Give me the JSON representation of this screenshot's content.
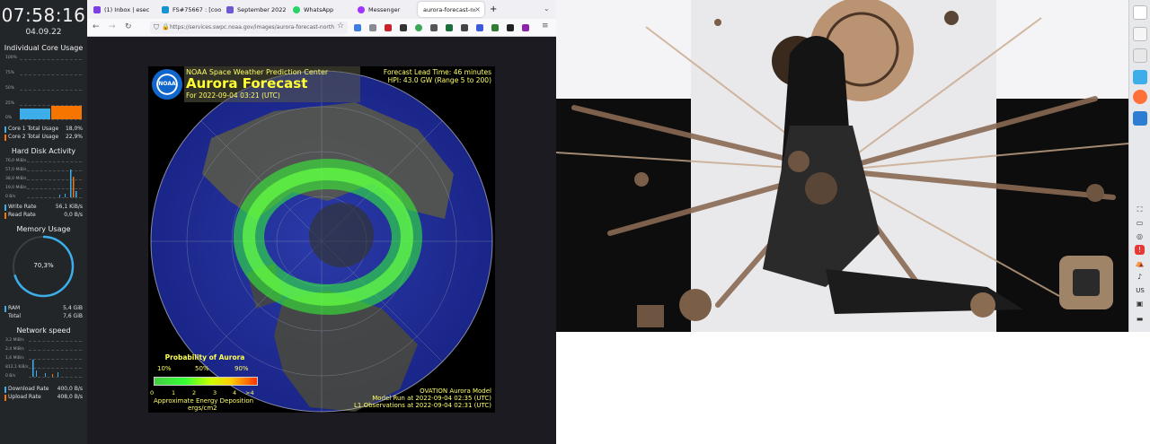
{
  "sysmon": {
    "clock": "07:58:16",
    "date": "04.09.22",
    "cpu": {
      "title": "Individual Core Usage",
      "axis": [
        "100%",
        "75%",
        "50%",
        "25%",
        "0%"
      ],
      "cores": [
        {
          "label": "Core 1 Total Usage",
          "value": "18,0%",
          "fraction": 0.18,
          "color": "#3daee9"
        },
        {
          "label": "Core 2 Total Usage",
          "value": "22,9%",
          "fraction": 0.229,
          "color": "#f67400"
        }
      ]
    },
    "disk": {
      "title": "Hard Disk Activity",
      "axis": [
        "76,0 MiB/s",
        "57,0 MiB/s",
        "38,0 MiB/s",
        "19,0 MiB/s",
        "0 B/s"
      ],
      "rows": [
        {
          "label": "Write Rate",
          "value": "56,1 KiB/s",
          "color": "#3daee9"
        },
        {
          "label": "Read Rate",
          "value": "0,0 B/s",
          "color": "#f67400"
        }
      ]
    },
    "memory": {
      "title": "Memory Usage",
      "percent_label": "70,3%",
      "fraction": 0.703,
      "rows": [
        {
          "label": "RAM",
          "value": "5,4 GiB",
          "color": "#3daee9"
        },
        {
          "label": "Total",
          "value": "7,6 GiB",
          "color": ""
        }
      ]
    },
    "network": {
      "title": "Network speed",
      "axis": [
        "3,2 MiB/s",
        "2,4 MiB/s",
        "1,6 MiB/s",
        "812,1 KiB/s",
        "0 B/s"
      ],
      "rows": [
        {
          "label": "Download Rate",
          "value": "400,0 B/s",
          "color": "#3daee9"
        },
        {
          "label": "Upload Rate",
          "value": "408,0 B/s",
          "color": "#f67400"
        }
      ]
    }
  },
  "browser": {
    "tabs": [
      {
        "label": "(1) Inbox | esec",
        "icon_color": "#7b3fe4"
      },
      {
        "label": "FS#75667 : [coo",
        "icon_color": "#1793d1"
      },
      {
        "label": "September 2022",
        "icon_color": "#6a5acd"
      },
      {
        "label": "WhatsApp",
        "icon_color": "#25d366"
      },
      {
        "label": "Messenger",
        "icon_color": "#a033ff"
      },
      {
        "label": "aurora-forecast-nor",
        "icon_color": ""
      }
    ],
    "new_tab": "+",
    "url": "https://services.swpc.noaa.gov/images/aurora-forecast-north"
  },
  "aurora": {
    "org": "NOAA Space Weather Prediction Center",
    "title": "Aurora Forecast",
    "for_line": "For 2022-09-04 03:21 (UTC)",
    "lead_time": "Forecast Lead Time:  46 minutes",
    "hpi": "HPI:  43.0 GW (Range 5 to 200)",
    "logo_text": "NOAA",
    "prob_title": "Probability of Aurora",
    "prob_ticks": [
      "10%",
      "50%",
      "90%"
    ],
    "scale": [
      "0",
      "1",
      "2",
      "3",
      "4",
      ">4"
    ],
    "energy": "Approximate Energy Deposition",
    "energy_unit": "ergs/cm2",
    "model": "OVATION Aurora Model",
    "model_run": "Model Run at 2022-09-04 02:35 (UTC)",
    "l1": "L1 Observations at 2022-09-04 02:31 (UTC)"
  },
  "panel": {
    "kbd_layout": "US"
  },
  "colors": {
    "accent_blue": "#3daee9",
    "accent_orange": "#f67400",
    "aurora_green": "#33ff33",
    "text_yellow": "#ffff66"
  }
}
